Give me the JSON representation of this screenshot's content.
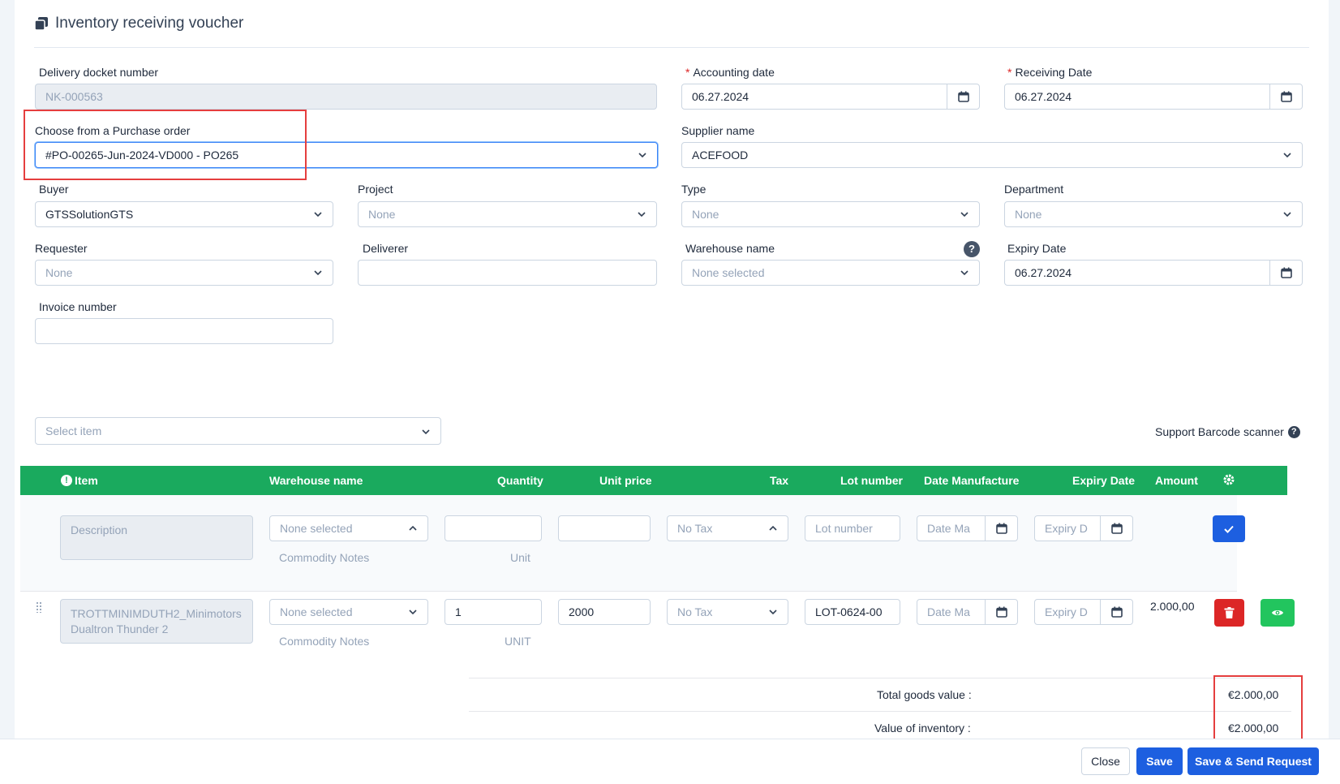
{
  "header": {
    "title": "Inventory receiving voucher"
  },
  "form": {
    "delivery_docket": {
      "label": "Delivery docket number",
      "value": "NK-000563"
    },
    "accounting_date": {
      "required": "*",
      "label": "Accounting date",
      "value": "06.27.2024"
    },
    "receiving_date": {
      "required": "*",
      "label": "Receiving Date",
      "value": "06.27.2024"
    },
    "purchase_order": {
      "label": "Choose from a Purchase order",
      "value": "#PO-00265-Jun-2024-VD000 - PO265"
    },
    "supplier": {
      "label": "Supplier name",
      "value": "ACEFOOD"
    },
    "buyer": {
      "label": "Buyer",
      "value": "GTSSolutionGTS"
    },
    "project": {
      "label": "Project",
      "value": "None"
    },
    "type": {
      "label": "Type",
      "value": "None"
    },
    "department": {
      "label": "Department",
      "value": "None"
    },
    "requester": {
      "label": "Requester",
      "value": "None"
    },
    "deliverer": {
      "label": "Deliverer",
      "value": ""
    },
    "warehouse": {
      "label": "Warehouse name",
      "value": "None selected",
      "help": "?"
    },
    "expiry_date": {
      "label": "Expiry Date",
      "value": "06.27.2024"
    },
    "invoice_number": {
      "label": "Invoice number",
      "value": ""
    }
  },
  "items_section": {
    "select_item_placeholder": "Select item",
    "barcode_label": "Support Barcode scanner",
    "columns": [
      "Item",
      "Warehouse name",
      "Quantity",
      "Unit price",
      "Tax",
      "Lot number",
      "Date Manufacture",
      "Expiry Date",
      "Amount"
    ],
    "new_row": {
      "description_placeholder": "Description",
      "warehouse": "None selected",
      "commodity_notes": "Commodity Notes",
      "unit": "Unit",
      "tax": "No Tax",
      "lot_placeholder": "Lot number",
      "date_mfg_placeholder": "Date Ma",
      "expiry_placeholder": "Expiry D"
    },
    "rows": [
      {
        "item": "TROTTMINIMDUTH2_Minimotors Dualtron Thunder 2",
        "warehouse": "None selected",
        "commodity_notes": "Commodity Notes",
        "quantity": "1",
        "unit": "UNIT",
        "unit_price": "2000",
        "tax": "No Tax",
        "lot": "LOT-0624-00",
        "date_mfg_placeholder": "Date Ma",
        "expiry_placeholder": "Expiry D",
        "amount": "2.000,00"
      }
    ]
  },
  "totals": {
    "total_goods_label": "Total goods value :",
    "total_goods_value": "€2.000,00",
    "inventory_label": "Value of inventory :",
    "inventory_value": "€2.000,00"
  },
  "footer": {
    "close": "Close",
    "save": "Save",
    "save_send": "Save & Send Request"
  },
  "colors": {
    "green": "#1aaa5e",
    "blue": "#1d5fe0",
    "red": "#dc2626",
    "highlight": "#e53e3e"
  }
}
